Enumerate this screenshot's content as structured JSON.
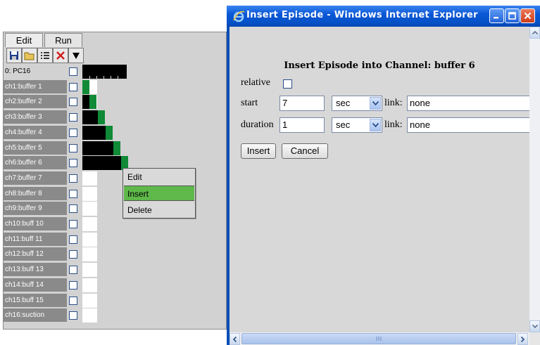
{
  "app": {
    "tabs": [
      {
        "label": "Edit"
      },
      {
        "label": "Run"
      }
    ],
    "toolbar": [
      {
        "icon": "save-icon"
      },
      {
        "icon": "open-folder-icon"
      },
      {
        "icon": "list-icon"
      },
      {
        "icon": "delete-x-icon"
      },
      {
        "icon": "dropdown-triangle-icon"
      }
    ],
    "channels": [
      {
        "label": "0: PC16",
        "black": 0.63,
        "green": 0
      },
      {
        "label": "ch1:buffer 1",
        "black": 0,
        "green": 0.1
      },
      {
        "label": "ch2:buffer 2",
        "black": 0.1,
        "green": 0.1
      },
      {
        "label": "ch3:buffer 3",
        "black": 0.22,
        "green": 0.1
      },
      {
        "label": "ch4:buffer 4",
        "black": 0.33,
        "green": 0.1
      },
      {
        "label": "ch5:buffer 5",
        "black": 0.44,
        "green": 0.1
      },
      {
        "label": "ch6:buffer 6",
        "black": 0.55,
        "green": 0.1
      },
      {
        "label": "ch7:buffer 7",
        "black": 0,
        "green": 0
      },
      {
        "label": "ch8:buffer 8",
        "black": 0,
        "green": 0
      },
      {
        "label": "ch9:buffer 9",
        "black": 0,
        "green": 0
      },
      {
        "label": "ch10:buff 10",
        "black": 0,
        "green": 0
      },
      {
        "label": "ch11:buff 11",
        "black": 0,
        "green": 0
      },
      {
        "label": "ch12:buff 12",
        "black": 0,
        "green": 0
      },
      {
        "label": "ch13:buff 13",
        "black": 0,
        "green": 0
      },
      {
        "label": "ch14:buff 14",
        "black": 0,
        "green": 0
      },
      {
        "label": "ch15:buff 15",
        "black": 0,
        "green": 0
      },
      {
        "label": "ch16:suction",
        "black": 0,
        "green": 0
      }
    ],
    "context_menu": {
      "items": [
        {
          "label": "Edit"
        },
        {
          "label": "Insert"
        },
        {
          "label": "Delete"
        }
      ],
      "highlighted": "Insert"
    },
    "colors": {
      "episode_dark": "#000000",
      "episode_green": "#108a36",
      "menu_highlight": "#5fb84a"
    }
  },
  "window": {
    "title": "Insert Episode - Windows Internet Explorer",
    "heading": "Insert Episode into Channel: buffer 6",
    "relative_label": "relative",
    "relative_checked": false,
    "start": {
      "label": "start",
      "value": "7",
      "unit": "sec",
      "link_label": "link:",
      "link_value": "none"
    },
    "duration": {
      "label": "duration",
      "value": "1",
      "unit": "sec",
      "link_label": "link:",
      "link_value": "none"
    },
    "insert_button": "Insert",
    "cancel_button": "Cancel",
    "colors": {
      "titlebar": "#0a57d6",
      "close_button": "#cc3c1a"
    }
  }
}
